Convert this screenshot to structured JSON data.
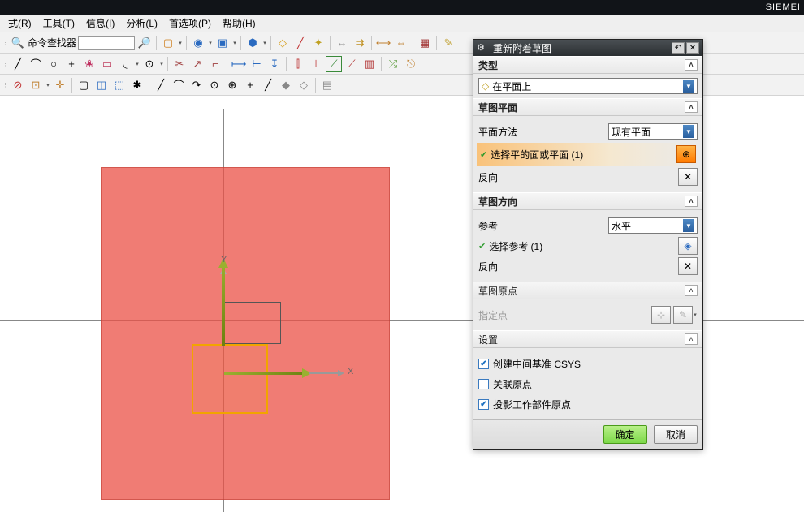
{
  "app": {
    "brand": "SIEMEI"
  },
  "menu": {
    "m1": "式(R)",
    "m2": "工具(T)",
    "m3": "信息(I)",
    "m4": "分析(L)",
    "m5": "首选项(P)",
    "m6": "帮助(H)"
  },
  "toolbar": {
    "finder_label": "命令查找器",
    "finder_value": ""
  },
  "canvas": {
    "x_label": "X",
    "y_label": "Y"
  },
  "dialog": {
    "title": "重新附着草图",
    "sect_type": "类型",
    "type_value": "在平面上",
    "sect_plane": "草图平面",
    "plane_method_label": "平面方法",
    "plane_method_value": "现有平面",
    "select_face_label": "选择平的面或平面 (1)",
    "reverse_label": "反向",
    "sect_dir": "草图方向",
    "ref_label": "参考",
    "ref_value": "水平",
    "select_ref_label": "选择参考 (1)",
    "reverse2_label": "反向",
    "sect_origin": "草图原点",
    "specify_pt": "指定点",
    "sect_settings": "设置",
    "chk1": "创建中间基准 CSYS",
    "chk2": "关联原点",
    "chk3": "投影工作部件原点",
    "ok": "确定",
    "cancel": "取消"
  }
}
